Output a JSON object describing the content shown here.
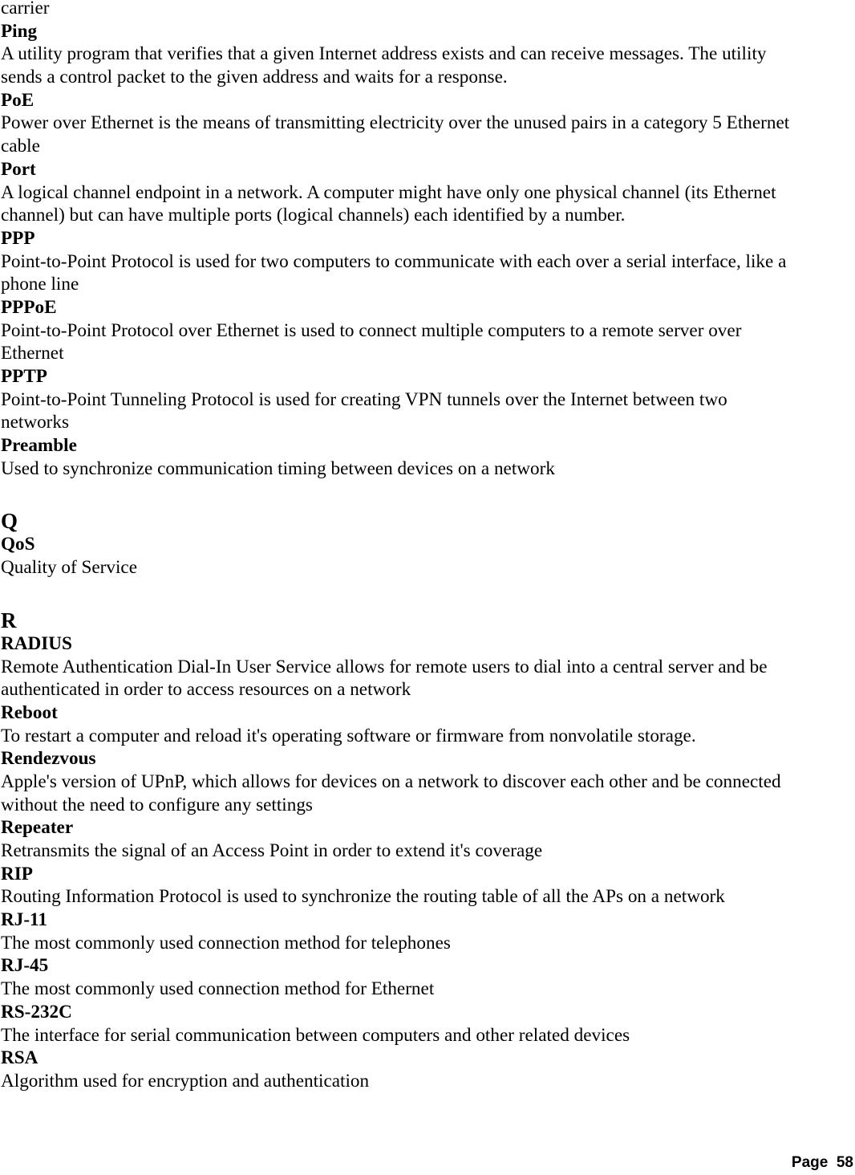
{
  "document": {
    "leading_fragment": "carrier",
    "entries_p": [
      {
        "term": "Ping",
        "lines": [
          "A utility program that verifies that a given Internet address exists and can receive messages. The utility",
          "sends a control packet to the given address and waits for a response."
        ]
      },
      {
        "term": "PoE",
        "lines": [
          "Power over Ethernet is the means of transmitting electricity over the unused pairs in a category 5 Ethernet",
          "cable"
        ]
      },
      {
        "term": "Port",
        "lines": [
          "A logical channel endpoint in a network. A computer might have only one physical channel (its Ethernet",
          "channel) but can have multiple ports (logical channels) each identified by a number."
        ]
      },
      {
        "term": "PPP",
        "lines": [
          "Point-to-Point Protocol is used for two computers to communicate with each over a serial interface, like a",
          "phone line"
        ]
      },
      {
        "term": "PPPoE",
        "lines": [
          "Point-to-Point Protocol over Ethernet is used to connect multiple computers to a remote server over",
          "Ethernet"
        ]
      },
      {
        "term": "PPTP",
        "lines": [
          "Point-to-Point Tunneling Protocol is used for creating VPN tunnels over the Internet between two",
          "networks"
        ]
      },
      {
        "term": "Preamble",
        "lines": [
          "Used to synchronize communication timing between devices on a network"
        ]
      }
    ],
    "section_q": {
      "letter": "Q",
      "entries": [
        {
          "term": "QoS",
          "lines": [
            "Quality of Service"
          ]
        }
      ]
    },
    "section_r": {
      "letter": "R",
      "entries": [
        {
          "term": "RADIUS",
          "lines": [
            "Remote Authentication Dial-In User Service allows for remote users to dial into a central server and be",
            "authenticated in order to access resources on a network"
          ]
        },
        {
          "term": "Reboot",
          "lines": [
            "To restart a computer and reload it's operating software or firmware from nonvolatile storage."
          ]
        },
        {
          "term": "Rendezvous",
          "lines": [
            "Apple's version of UPnP, which allows for devices on a network to discover each other and be connected",
            "without the need to configure any settings"
          ]
        },
        {
          "term": "Repeater",
          "lines": [
            "Retransmits the signal of an Access Point in order to extend it's coverage"
          ]
        },
        {
          "term": "RIP",
          "lines": [
            "Routing Information Protocol is used to synchronize the routing table of all the APs on a network"
          ]
        },
        {
          "term": "RJ-11",
          "lines": [
            "The most commonly used connection method for telephones"
          ]
        },
        {
          "term": "RJ-45",
          "lines": [
            "The most commonly used connection method for Ethernet"
          ]
        },
        {
          "term": "RS-232C",
          "lines": [
            "The interface for serial communication between computers and other related devices"
          ]
        },
        {
          "term": "RSA",
          "lines": [
            "Algorithm used for encryption and authentication"
          ]
        }
      ]
    },
    "footer": {
      "page_label": "Page  58"
    }
  }
}
